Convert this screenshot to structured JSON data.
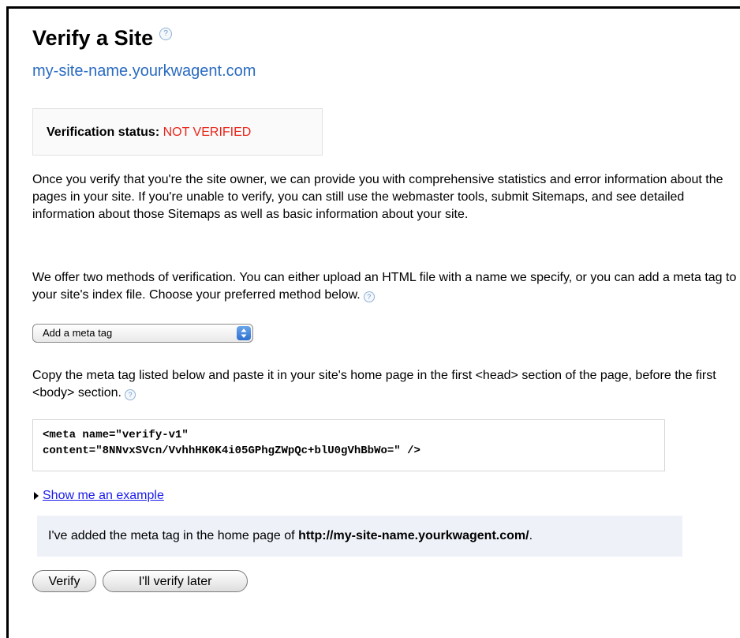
{
  "page": {
    "title": "Verify a Site",
    "help_glyph": "?",
    "site_name": "my-site-name.yourkwagent.com"
  },
  "status": {
    "label": "Verification status:",
    "value": "NOT VERIFIED",
    "value_color": "#e9261b"
  },
  "paragraphs": {
    "intro": "Once you verify that you're the site owner, we can provide you with comprehensive statistics and error information about the pages in your site. If you're unable to verify, you can still use the webmaster tools, submit Sitemaps, and see detailed information about those Sitemaps as well as basic information about your site.",
    "methods": "We offer two methods of verification. You can either upload an HTML file with a name we specify, or you can add a meta tag to your site's index file. Choose your preferred method below.",
    "copy_instructions": "Copy the meta tag listed below and paste it in your site's home page in the first <head> section of the page, before the first <body> section."
  },
  "method_select": {
    "selected": "Add a meta tag",
    "arrows_glyph": "▲▼"
  },
  "meta_tag": {
    "line1": "<meta name=\"verify-v1\"",
    "line2": "content=\"8NNvxSVcn/VvhhHK0K4i05GPhgZWpQc+blU0gVhBbWo=\" />"
  },
  "example": {
    "link": "Show me an example"
  },
  "confirmation": {
    "prefix": "I've added the meta tag in the home page of ",
    "url": "http://my-site-name.yourkwagent.com/",
    "suffix": "."
  },
  "buttons": {
    "verify": "Verify",
    "later": "I'll verify later"
  },
  "colors": {
    "link_blue": "#2a6bc1",
    "hyperlink": "#1a1aee",
    "confirm_bg": "#eef2f8"
  }
}
